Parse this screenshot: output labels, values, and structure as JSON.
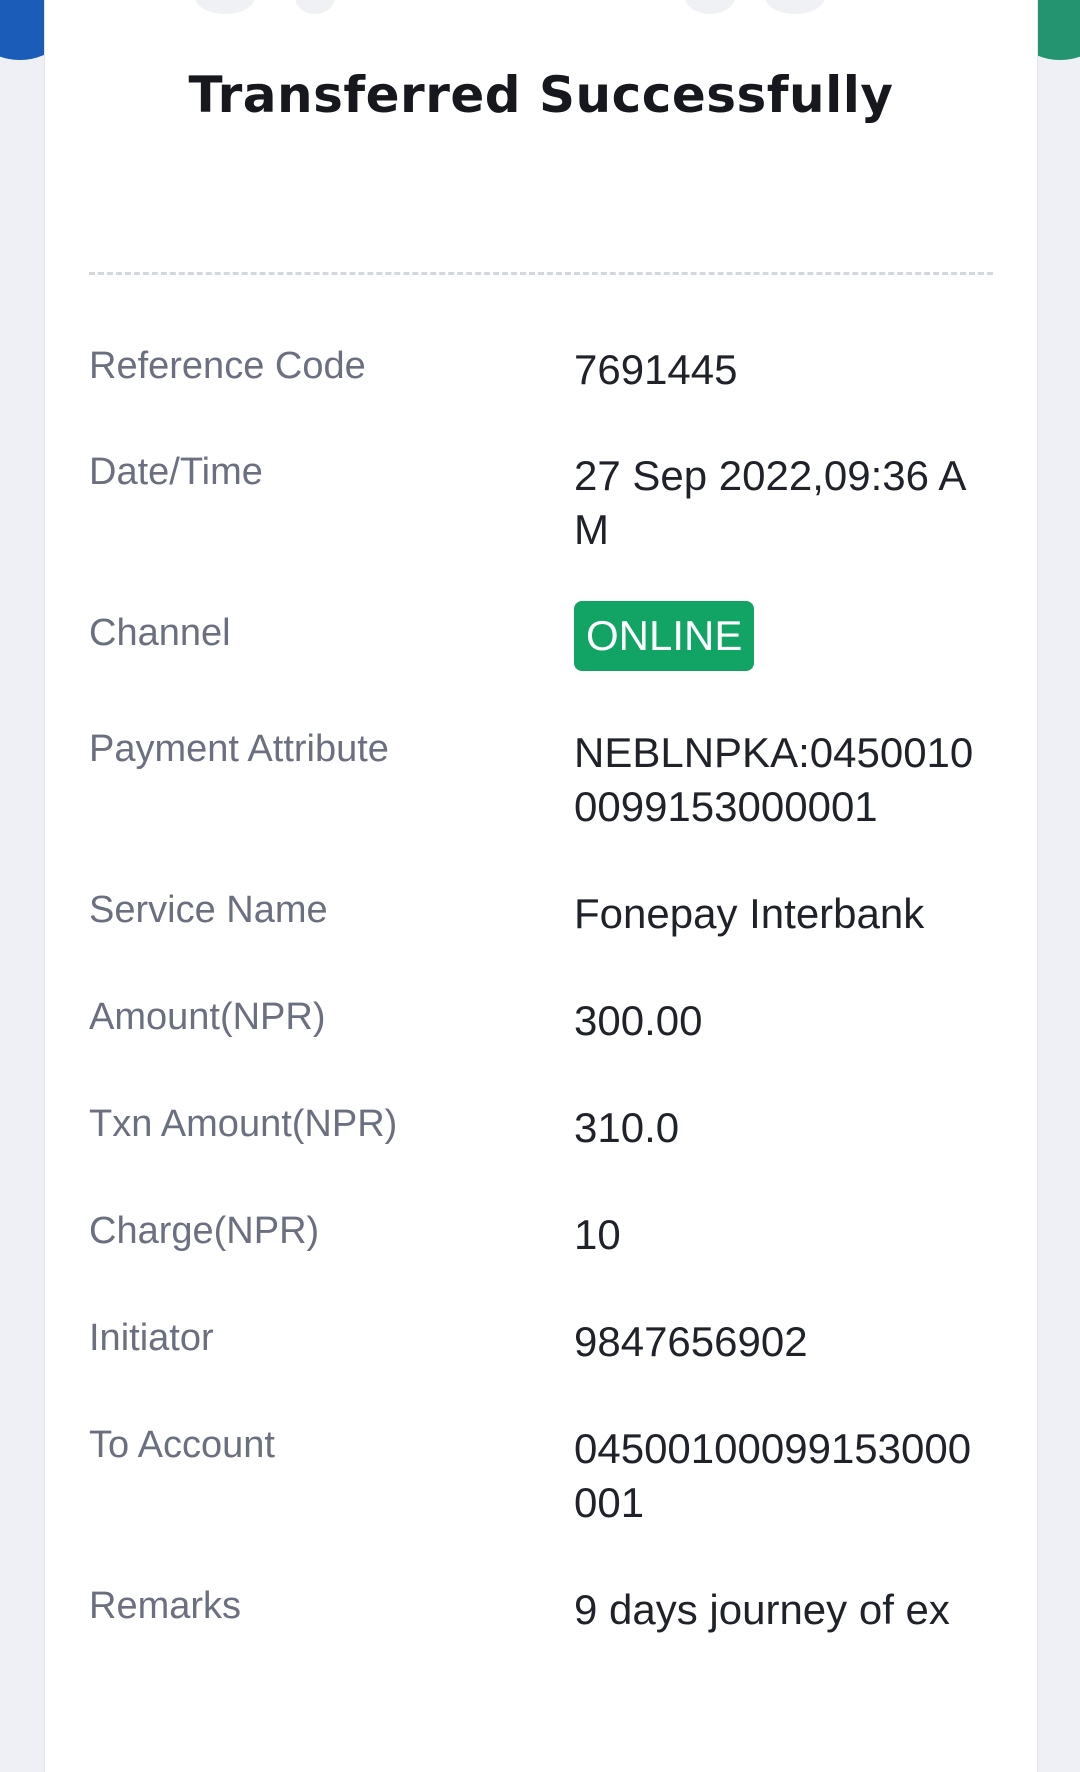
{
  "header": {
    "title": "Transferred Successfully"
  },
  "colors": {
    "accent_blue": "#1a5cb8",
    "accent_green": "#23946f",
    "badge_green": "#12a464"
  },
  "details": [
    {
      "id": "reference-code",
      "label": "Reference Code",
      "value": "7691445"
    },
    {
      "id": "date-time",
      "label": "Date/Time",
      "value": "27 Sep 2022,09:36 AM"
    },
    {
      "id": "channel",
      "label": "Channel",
      "value": "ONLINE"
    },
    {
      "id": "payment-attribute",
      "label": "Payment Attribute",
      "value": "NEBLNPKA:04500100099153000001"
    },
    {
      "id": "service-name",
      "label": "Service Name",
      "value": "Fonepay Interbank"
    },
    {
      "id": "amount",
      "label": "Amount(NPR)",
      "value": "300.00"
    },
    {
      "id": "txn-amount",
      "label": "Txn Amount(NPR)",
      "value": "310.0"
    },
    {
      "id": "charge",
      "label": "Charge(NPR)",
      "value": "10"
    },
    {
      "id": "initiator",
      "label": "Initiator",
      "value": "9847656902"
    },
    {
      "id": "to-account",
      "label": "To Account",
      "value": "04500100099153000001"
    },
    {
      "id": "remarks",
      "label": "Remarks",
      "value": "9 days journey of ex"
    }
  ]
}
